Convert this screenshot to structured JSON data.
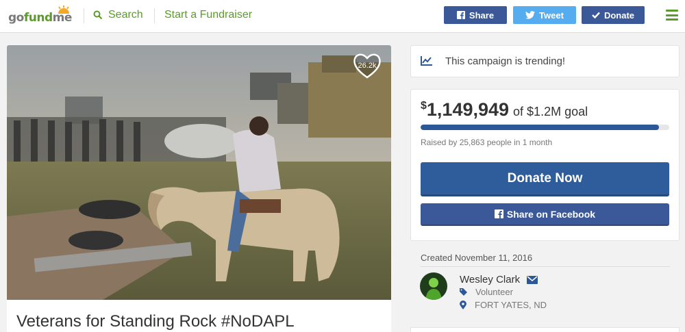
{
  "header": {
    "logo": {
      "part1": "go",
      "part2": "fund",
      "part3": "me"
    },
    "search_label": "Search",
    "start_label": "Start a Fundraiser",
    "share_label": "Share",
    "tweet_label": "Tweet",
    "donate_label": "Donate"
  },
  "campaign": {
    "title": "Veterans for Standing Rock #NoDAPL",
    "heart_count": "26.2k"
  },
  "trending": {
    "text": "This campaign is trending!"
  },
  "goal": {
    "currency": "$",
    "amount": "1,149,949",
    "goal_text": "of $1.2M goal",
    "progress": 0.958,
    "raised_by": "Raised by 25,863 people in 1 month",
    "donate_now": "Donate Now",
    "share_facebook": "Share on Facebook"
  },
  "organizer": {
    "created": "Created November 11, 2016",
    "name": "Wesley Clark",
    "role": "Volunteer",
    "location": "FORT YATES, ND"
  },
  "colors": {
    "brand_green": "#5a9b2a",
    "facebook_blue": "#3b5998",
    "twitter_blue": "#55acee",
    "donate_blue": "#2f5c9a"
  }
}
